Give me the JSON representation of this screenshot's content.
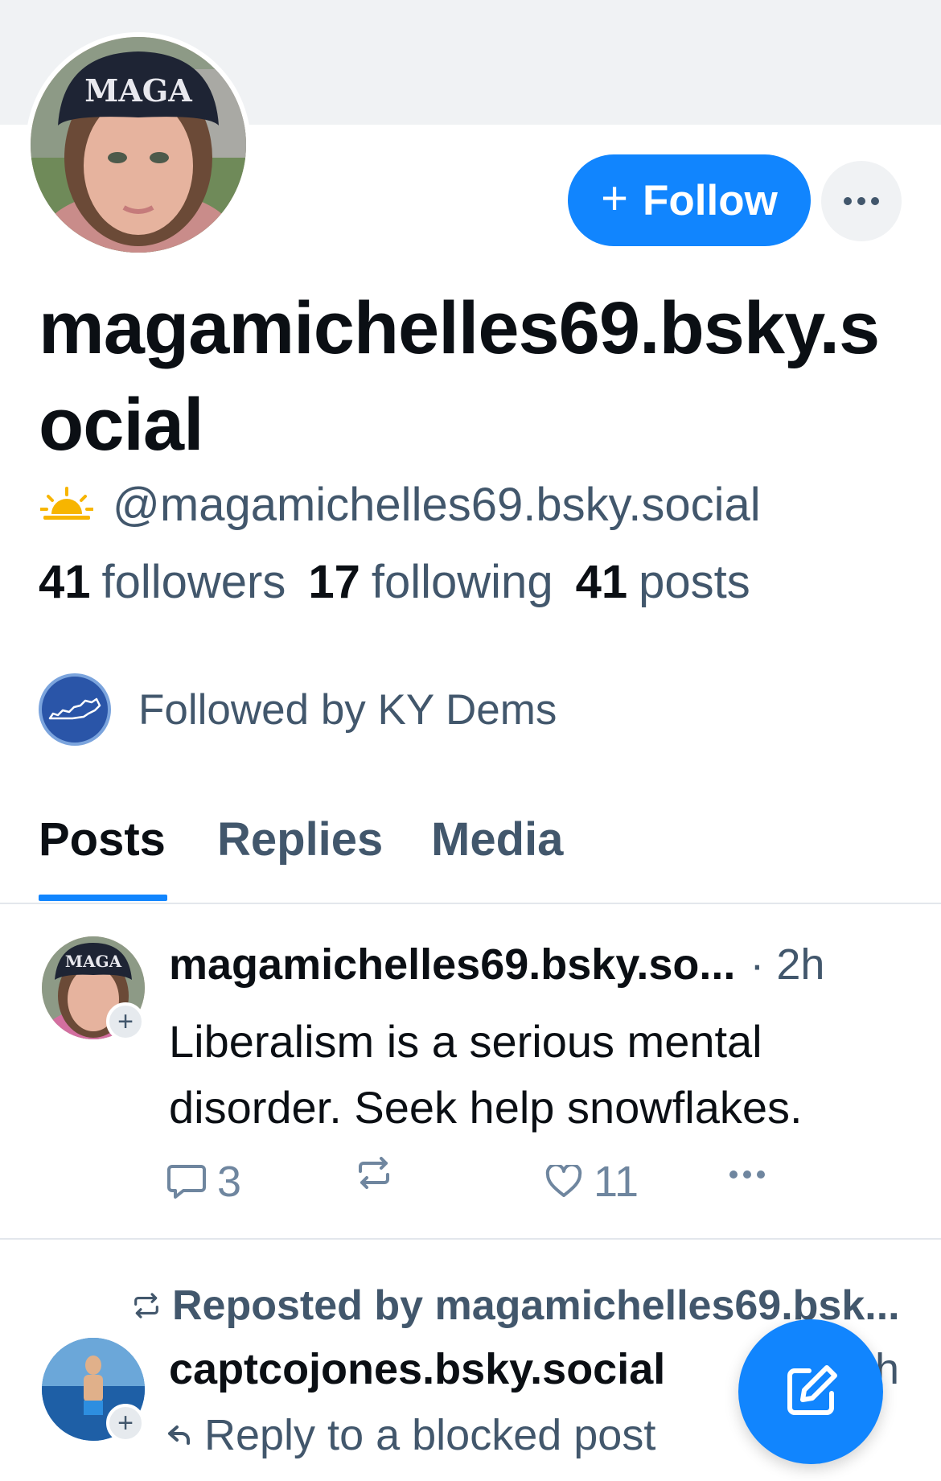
{
  "profile": {
    "display_name": "magamichelles69.bsky.social",
    "handle": "@magamichelles69.bsky.social",
    "handle_icon": "sunrise-icon",
    "avatar_hat_text": "MAGA",
    "follow_button_plus": "+",
    "follow_button_label": "Follow",
    "more_button_label": "···",
    "stats": {
      "followers_count": "41",
      "followers_label": "followers",
      "following_count": "17",
      "following_label": "following",
      "posts_count": "41",
      "posts_label": "posts"
    },
    "followed_by_text": "Followed by KY Dems"
  },
  "tabs": [
    {
      "label": "Posts",
      "active": true
    },
    {
      "label": "Replies",
      "active": false
    },
    {
      "label": "Media",
      "active": false
    }
  ],
  "posts": [
    {
      "author": "magamichelles69.bsky.so...",
      "time": "· 2h",
      "avatar_hat_text": "MAGA",
      "text": "Liberalism is a serious mental disorder. Seek help snowflakes.",
      "reply_count": "3",
      "repost_count": "",
      "like_count": "11",
      "more_label": "···"
    },
    {
      "repost_text": "Reposted by magamichelles69.bsk...",
      "author": "captcojones.bsky.social",
      "time": "h",
      "reply_text": "Reply to a blocked post"
    }
  ],
  "colors": {
    "accent": "#1185fe",
    "text_primary": "#0b0f14",
    "text_secondary": "#42576c",
    "banner": "#f0f2f4"
  }
}
